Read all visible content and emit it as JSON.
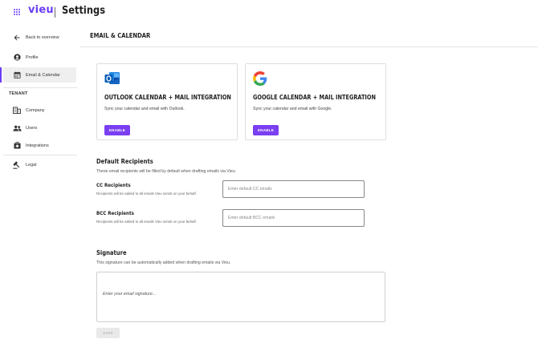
{
  "header": {
    "logo": "vieu",
    "title": "Settings"
  },
  "sidebar": {
    "back_label": "Back to overview",
    "items": [
      {
        "label": "Profile",
        "icon": "profile-icon"
      },
      {
        "label": "Email & Calendar",
        "icon": "calendar-icon",
        "active": true
      }
    ],
    "tenant_label": "TENANT",
    "tenant_items": [
      {
        "label": "Company",
        "icon": "building-icon"
      },
      {
        "label": "Users",
        "icon": "users-icon"
      },
      {
        "label": "Integrations",
        "icon": "integrations-icon"
      },
      {
        "label": "Legal",
        "icon": "gavel-icon"
      }
    ]
  },
  "main": {
    "title": "EMAIL & CALENDAR",
    "cards": [
      {
        "title": "OUTLOOK CALENDAR + MAIL INTEGRATION",
        "description": "Sync your calendar and email with Outlook.",
        "button": "ENABLE",
        "icon": "outlook-logo"
      },
      {
        "title": "GOOGLE CALENDAR + MAIL INTEGRATION",
        "description": "Sync your calendar and email with Google.",
        "button": "ENABLE",
        "icon": "google-logo"
      }
    ],
    "default_recipients": {
      "title": "Default Recipients",
      "description": "These email recipients will be filled by default when drafting emails via Vieu.",
      "cc": {
        "title": "CC Recipients",
        "description": "Recipients will be added to all emails Vieu sends on your behalf.",
        "placeholder": "Enter default CC emails",
        "value": ""
      },
      "bcc": {
        "title": "BCC Recipients",
        "description": "Recipients will be added to all emails Vieu sends on your behalf.",
        "placeholder": "Enter default BCC emails",
        "value": ""
      }
    },
    "signature": {
      "title": "Signature",
      "description": "This signature can be automatically added when drafting emails via Vieu.",
      "placeholder": "Enter your email signature...",
      "value": ""
    },
    "save_label": "SAVE"
  },
  "colors": {
    "accent": "#6a3df5",
    "button": "#7a3ff2",
    "active_bg": "#efefef",
    "disabled_bg": "#e9e9e9"
  }
}
